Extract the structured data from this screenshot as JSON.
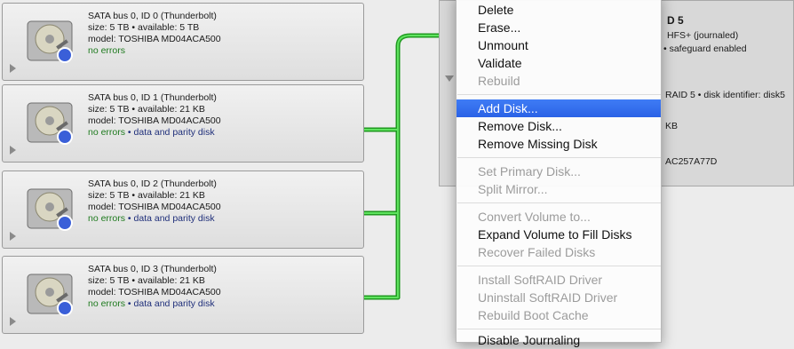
{
  "disks": [
    {
      "line1": "SATA bus 0, ID 0 (Thunderbolt)",
      "line2": "size: 5 TB • available: 5 TB",
      "line3": "model: TOSHIBA MD04ACA500",
      "status": "no errors",
      "role": ""
    },
    {
      "line1": "SATA bus 0, ID 1 (Thunderbolt)",
      "line2": "size: 5 TB • available: 21 KB",
      "line3": "model: TOSHIBA MD04ACA500",
      "status": "no errors",
      "role": " • data and parity disk"
    },
    {
      "line1": "SATA bus 0, ID 2 (Thunderbolt)",
      "line2": "size: 5 TB • available: 21 KB",
      "line3": "model: TOSHIBA MD04ACA500",
      "status": "no errors",
      "role": " • data and parity disk"
    },
    {
      "line1": "SATA bus 0, ID 3 (Thunderbolt)",
      "line2": "size: 5 TB • available: 21 KB",
      "line3": "model: TOSHIBA MD04ACA500",
      "status": "no errors",
      "role": " • data and parity disk"
    }
  ],
  "volume": {
    "title_partial": "D 5",
    "l1": "HFS+ (journaled)",
    "l2": "• safeguard enabled",
    "l3": "RAID 5 • disk identifier: disk5",
    "l4": "KB",
    "l5": "AC257A77D"
  },
  "menu": {
    "items": {
      "delete": "Delete",
      "erase": "Erase...",
      "unmount": "Unmount",
      "validate": "Validate",
      "rebuild": "Rebuild",
      "add_disk": "Add Disk...",
      "remove_disk": "Remove Disk...",
      "remove_missing": "Remove Missing Disk",
      "set_primary": "Set Primary Disk...",
      "split_mirror": "Split Mirror...",
      "convert_volume": "Convert Volume to...",
      "expand_volume": "Expand Volume to Fill Disks",
      "recover_failed": "Recover Failed Disks",
      "install_driver": "Install SoftRAID Driver",
      "uninstall_driver": "Uninstall SoftRAID Driver",
      "rebuild_cache": "Rebuild Boot Cache",
      "disable_partial": "Disable Journaling"
    }
  },
  "colors": {
    "accent": "#2a62e6",
    "connector": "#2fb82f",
    "status_ok": "#1e7a1e",
    "status_role": "#1f2f7a"
  }
}
